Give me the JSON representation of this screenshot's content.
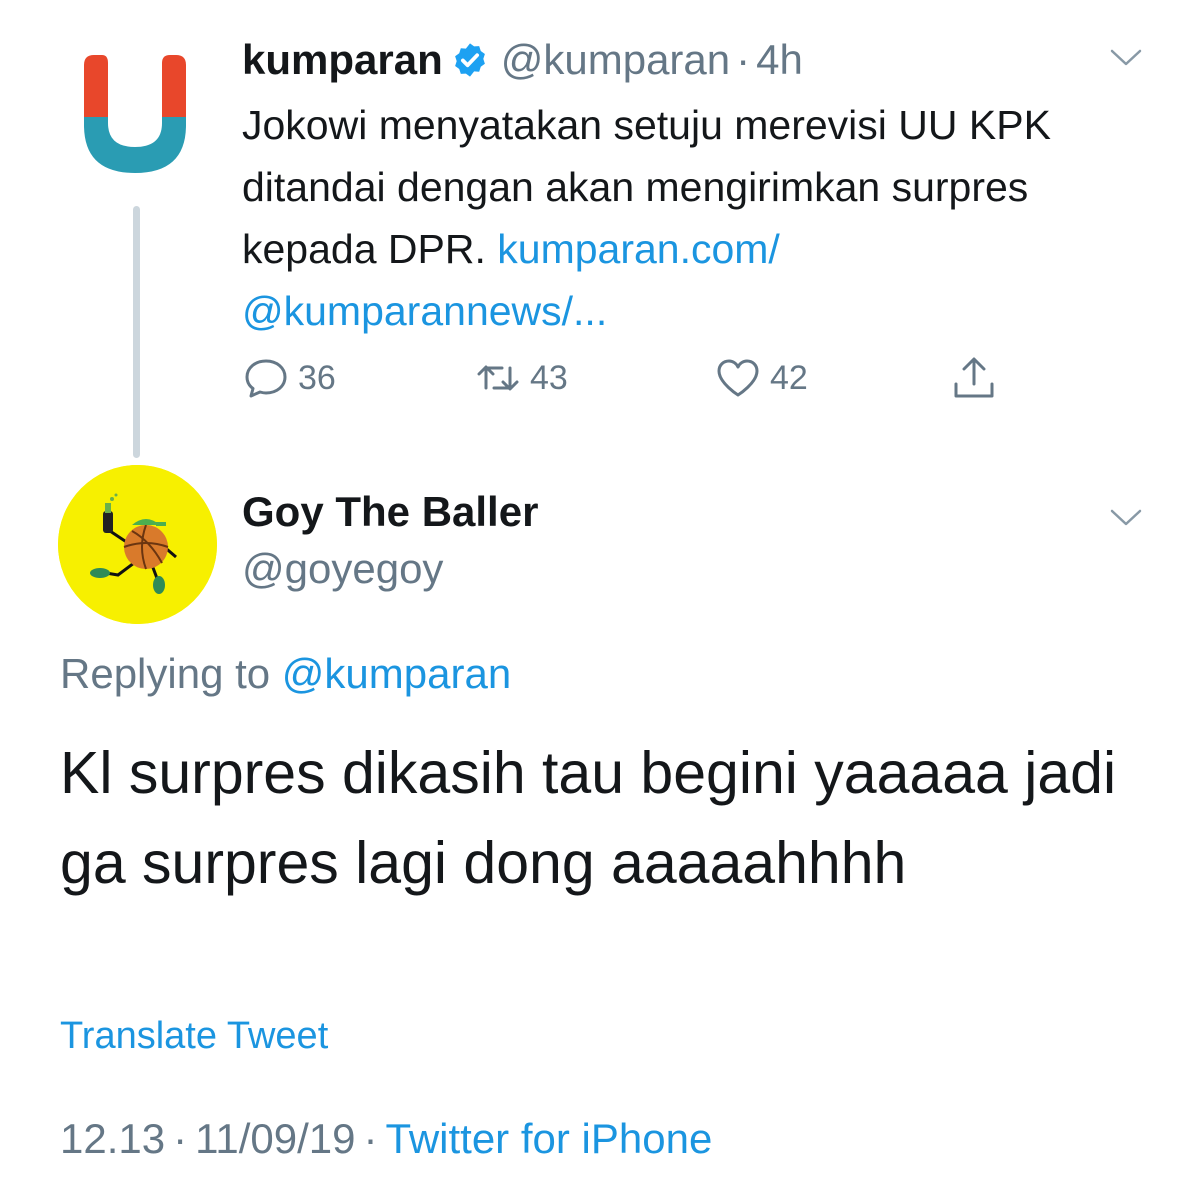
{
  "parent_tweet": {
    "name": "kumparan",
    "handle": "@kumparan",
    "separator": "·",
    "time": "4h",
    "text_plain": "Jokowi menyatakan setuju merevisi UU KPK ditandai dengan akan mengirimkan surpres kepada DPR.",
    "text_link": "kumparan.com/ @kumparannews/...",
    "stats": {
      "replies": "36",
      "retweets": "43",
      "likes": "42"
    },
    "icons": [
      "verified-badge-icon",
      "chevron-down-icon",
      "reply-icon",
      "retweet-icon",
      "heart-icon",
      "share-icon"
    ]
  },
  "reply_tweet": {
    "name": "Goy The Baller",
    "handle": "@goyegoy",
    "replying_label": "Replying to",
    "replying_mention": "@kumparan",
    "text": "Kl surpres dikasih tau begini yaaaaa jadi ga surpres lagi dong aaaaahhhh",
    "translate_label": "Translate Tweet",
    "time": "12.13",
    "date": "11/09/19",
    "separator": "·",
    "source": "Twitter for iPhone"
  },
  "colors": {
    "text_primary": "#14171a",
    "text_secondary": "#657786",
    "link": "#1b95e0",
    "verified": "#1da1f2",
    "thread_line": "#ccd6dd",
    "goy_avatar_bg": "#f7f000",
    "kumparan_red": "#e8472b",
    "kumparan_teal": "#2a9cb3"
  }
}
